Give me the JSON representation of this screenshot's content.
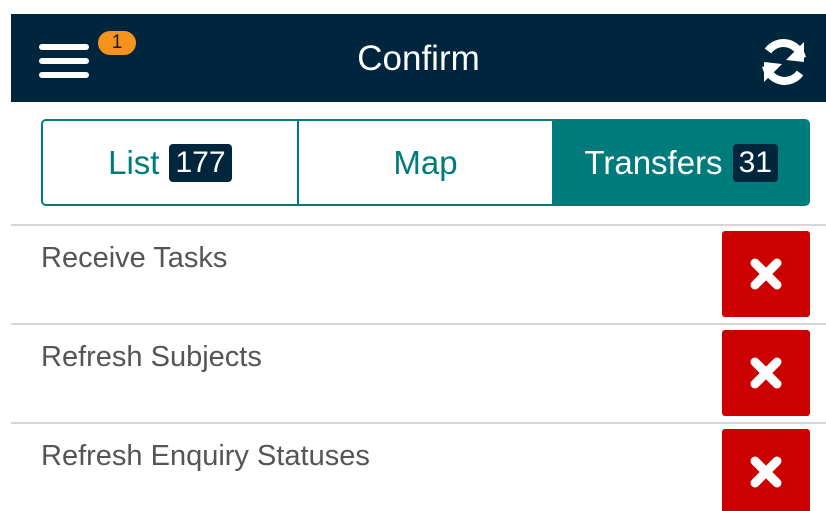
{
  "header": {
    "title": "Confirm",
    "menu_icon": "hamburger-menu-icon",
    "notification_count": "1",
    "refresh_icon": "refresh-icon"
  },
  "tabs": [
    {
      "label": "List",
      "count": "177",
      "active": false
    },
    {
      "label": "Map",
      "count": "",
      "active": false
    },
    {
      "label": "Transfers",
      "count": "31",
      "active": true
    }
  ],
  "tasks": [
    {
      "label": "Receive Tasks",
      "action_icon": "close-icon"
    },
    {
      "label": "Refresh Subjects",
      "action_icon": "close-icon"
    },
    {
      "label": "Refresh Enquiry Statuses",
      "action_icon": "close-icon"
    }
  ],
  "colors": {
    "header_bg": "#00263e",
    "accent_teal": "#007b7b",
    "badge_orange": "#f6921e",
    "delete_red": "#cc0000"
  }
}
